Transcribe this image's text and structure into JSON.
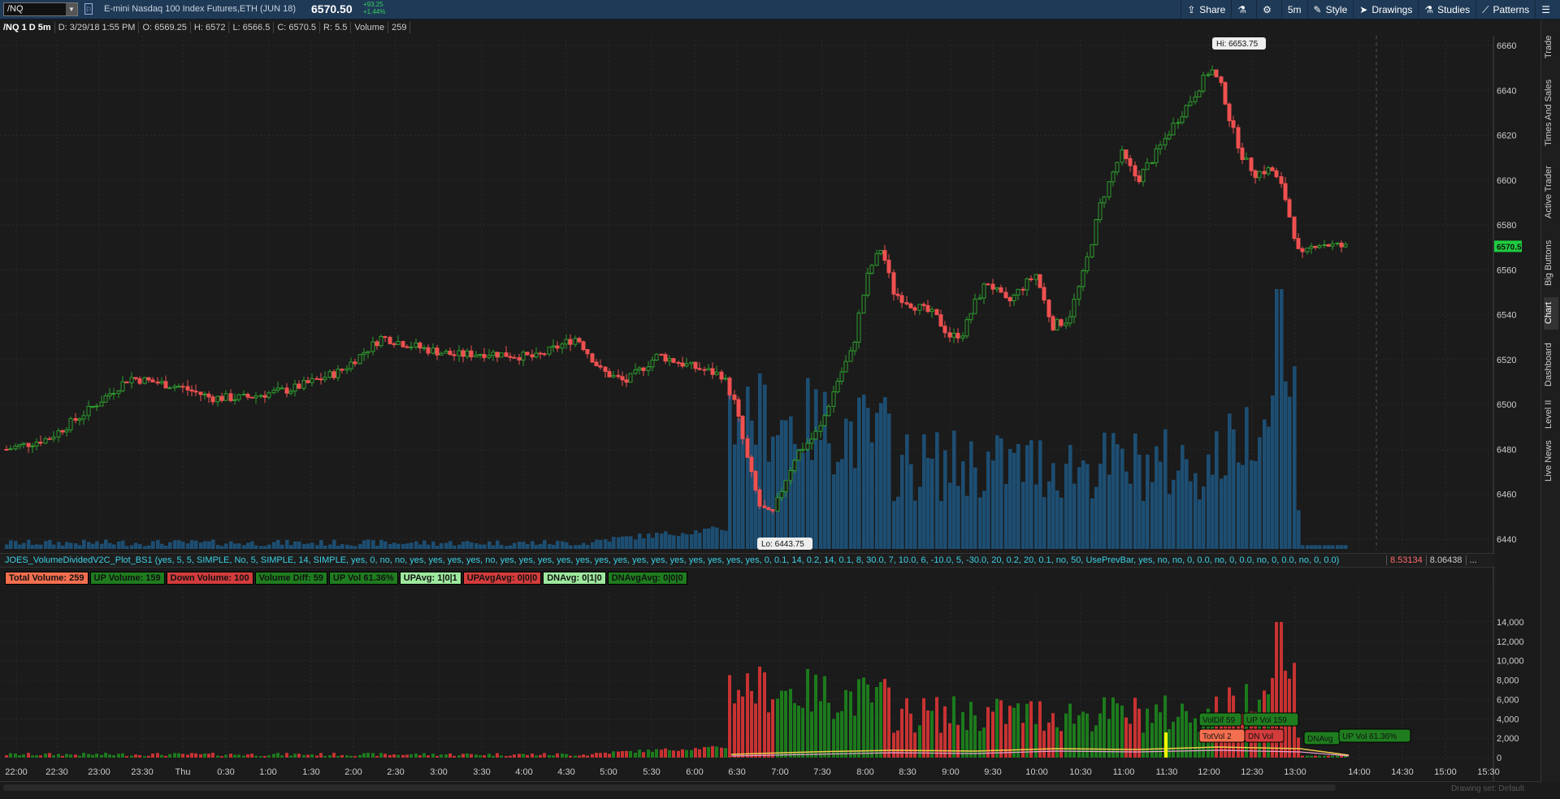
{
  "toolbar": {
    "symbol": "/NQ",
    "description": "E-mini Nasdaq 100 Index Futures,ETH (JUN 18)",
    "last": "6570.50",
    "change": "+93.25",
    "change_pct": "+1.44%",
    "buttons": [
      {
        "icon": "share-icon",
        "label": "Share"
      },
      {
        "icon": "flask-icon",
        "label": ""
      },
      {
        "icon": "gear-icon",
        "label": ""
      },
      {
        "icon": "",
        "label": "5m"
      },
      {
        "icon": "style-icon",
        "label": "Style"
      },
      {
        "icon": "cursor-icon",
        "label": "Drawings"
      },
      {
        "icon": "flask-icon",
        "label": "Studies"
      },
      {
        "icon": "patterns-icon",
        "label": "Patterns"
      },
      {
        "icon": "menu-icon",
        "label": ""
      }
    ]
  },
  "info": {
    "symbol_period": "/NQ 1 D 5m",
    "date": "D: 3/29/18 1:55 PM",
    "open": "O: 6569.25",
    "high": "H: 6572",
    "low": "L: 6566.5",
    "close": "C: 6570.5",
    "range": "R: 5.5",
    "volume_label": "Volume",
    "volume": "259"
  },
  "sidebar_tabs": [
    "Trade",
    "Times And Sales",
    "Active Trader",
    "Big Buttons",
    "Chart",
    "Dashboard",
    "Level II",
    "Live News"
  ],
  "study_line": "JOES_VolumeDividedV2C_Plot_BS1 (yes, 5, 5, SIMPLE, No, 5, SIMPLE, 14, SIMPLE, yes, 0, no, no, yes, yes, yes, yes, no, yes, yes, yes, yes, yes, yes, yes, yes, yes, yes, yes, yes, yes, yes, 0, 0.1, 14, 0.2, 14, 0.1, 8, 30.0, 7, 10.0, 6, -10.0, 5, -30.0, 20, 0.2, 20, 0.1, no, 50, UsePrevBar, yes, no, no, 0, 0.0, no, 0, 0.0, no, 0, 0.0, no, 0, 0.0)",
  "study_values": [
    "8.53134",
    "8.06438",
    "..."
  ],
  "study_labels": [
    {
      "text": "Total Volume: 259",
      "bg": "#f36f4f",
      "fg": "#111"
    },
    {
      "text": "UP Volume: 159",
      "bg": "#1f7d1f",
      "fg": "#111"
    },
    {
      "text": "Down Volume: 100",
      "bg": "#d23c3c",
      "fg": "#111"
    },
    {
      "text": "Volume Diff: 59",
      "bg": "#1f7d1f",
      "fg": "#111"
    },
    {
      "text": "UP Vol 61.36%",
      "bg": "#1f7d1f",
      "fg": "#111"
    },
    {
      "text": "UPAvg: 1|0|1",
      "bg": "#9ee89e",
      "fg": "#111"
    },
    {
      "text": "UPAvgAvg: 0|0|0",
      "bg": "#d23c3c",
      "fg": "#111"
    },
    {
      "text": "DNAvg: 0|1|0",
      "bg": "#9ee89e",
      "fg": "#111"
    },
    {
      "text": "DNAvgAvg: 0|0|0",
      "bg": "#1f7d1f",
      "fg": "#111"
    }
  ],
  "price_axis": {
    "ticks": [
      "6660",
      "6640",
      "6620",
      "6600",
      "6580",
      "6560",
      "6540",
      "6520",
      "6500",
      "6480",
      "6460",
      "6440"
    ],
    "current": "6570.5",
    "hi": "Hi: 6653.75",
    "lo": "Lo: 6443.75"
  },
  "lower_axis": {
    "ticks": [
      "14,000",
      "12,000",
      "10,000",
      "8,000",
      "6,000",
      "4,000",
      "2,000",
      "0"
    ]
  },
  "time_axis": [
    "22:00",
    "22:30",
    "23:00",
    "23:30",
    "Thu",
    "0:30",
    "1:00",
    "1:30",
    "2:00",
    "2:30",
    "3:00",
    "3:30",
    "4:00",
    "4:30",
    "5:00",
    "5:30",
    "6:00",
    "6:30",
    "7:00",
    "7:30",
    "8:00",
    "8:30",
    "9:00",
    "9:30",
    "10:00",
    "10:30",
    "11:00",
    "11:30",
    "12:00",
    "12:30",
    "13:00",
    "14:00",
    "14:30",
    "15:00",
    "15:30"
  ],
  "bubbles": [
    {
      "text": "VolDif 59",
      "bg": "#1f7d1f"
    },
    {
      "text": "UP Vol 159",
      "bg": "#1f7d1f"
    },
    {
      "text": "TotVol 2",
      "bg": "#f36f4f"
    },
    {
      "text": "DN Vol",
      "bg": "#d23c3c"
    },
    {
      "text": "DNAvg",
      "bg": "#1f7d1f"
    },
    {
      "text": "UP Vol 61.36%",
      "bg": "#1f7d1f"
    }
  ],
  "drawing_set": "Drawing set: Default",
  "colors": {
    "up": "#2e9c2e",
    "down": "#f05050",
    "volume": "#1d4e72",
    "bg": "#1b1b1b",
    "accent": "#1f3a57"
  }
}
